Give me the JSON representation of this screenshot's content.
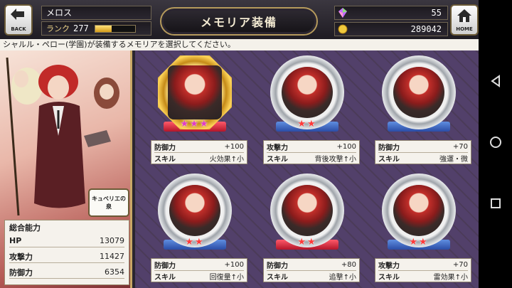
{
  "header": {
    "back_label": "BACK",
    "home_label": "HOME",
    "player_name": "メロス",
    "rank_label": "ランク",
    "rank_value": "277",
    "rank_progress": 0.42,
    "title": "メモリア装備",
    "crystals": "55",
    "gold": "289042"
  },
  "instruction": "シャルル・ペロー(学園)が装備するメモリアを選択してください。",
  "character": {
    "fountain_badge": "キュベリエの泉",
    "stats_title": "総合能力",
    "stats": [
      {
        "label": "HP",
        "value": "13079"
      },
      {
        "label": "攻撃力",
        "value": "11427"
      },
      {
        "label": "防御力",
        "value": "6354"
      }
    ]
  },
  "memoria": [
    {
      "stat": "防御力",
      "stat_value": "+100",
      "skill_label": "スキル",
      "skill": "火効果↑小",
      "frame": "gold",
      "stars": "★★★"
    },
    {
      "stat": "攻撃力",
      "stat_value": "+100",
      "skill_label": "スキル",
      "skill": "背後攻撃↑小",
      "frame": "silver",
      "stars": "★★"
    },
    {
      "stat": "防御力",
      "stat_value": "+70",
      "skill_label": "スキル",
      "skill": "強運・微",
      "frame": "silver",
      "stars": ""
    },
    {
      "stat": "防御力",
      "stat_value": "+100",
      "skill_label": "スキル",
      "skill": "回復量↑小",
      "frame": "silver",
      "stars": "★★"
    },
    {
      "stat": "防御力",
      "stat_value": "+80",
      "skill_label": "スキル",
      "skill": "追撃↑小",
      "frame": "silver",
      "stars": "★★"
    },
    {
      "stat": "攻撃力",
      "stat_value": "+70",
      "skill_label": "スキル",
      "skill": "雷効果↑小",
      "frame": "silver",
      "stars": "★★"
    }
  ],
  "icons": {
    "back": "back-arrow-icon",
    "home": "home-icon",
    "crystal": "crystal-icon",
    "coin": "coin-icon",
    "nav_back": "triangle-back-icon",
    "nav_home": "circle-home-icon",
    "nav_recent": "square-recent-icon"
  },
  "colors": {
    "accent_gold": "#b59a5c",
    "grid_bg": "#4b3b59"
  }
}
